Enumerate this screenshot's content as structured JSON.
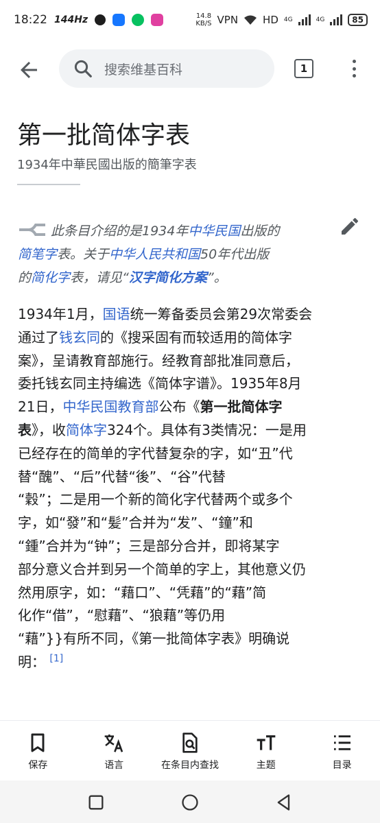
{
  "status_bar": {
    "time": "18:22",
    "refresh_rate": "144Hz",
    "net_speed_value": "14.8",
    "net_speed_unit": "KB/S",
    "vpn": "VPN",
    "hd": "HD",
    "network_1": "4G",
    "network_2": "4G",
    "battery": "85"
  },
  "top_bar": {
    "search_placeholder": "搜索维基百科",
    "tab_count": "1"
  },
  "article": {
    "title": "第一批简体字表",
    "description": "1934年中華民國出版的簡筆字表"
  },
  "hatnote": {
    "l1_a": "此条目介绍的是1934年",
    "l1_link": "中华民国",
    "l1_b": "出版的",
    "l2_link1": "简笔字",
    "l2_a": "表。关于",
    "l2_link2": "中华人民共和国",
    "l2_b": "50年代出版",
    "l3_a": "的",
    "l3_link1": "简化字",
    "l3_b": "表，请见“",
    "l3_link2": "汉字简化方案",
    "l3_c": "”。"
  },
  "body": {
    "l1_a": "1934年1月，",
    "l1_link": "国语",
    "l1_b": "统一筹备委员会第29次常委会",
    "l2_a": "通过了",
    "l2_link": "钱玄同",
    "l2_b": "的《搜采固有而较适用的简体字",
    "l3": "案》，呈请教育部施行。经教育部批准同意后，",
    "l4": "委托钱玄同主持编选《简体字谱》。1935年8月",
    "l5_a": "21日，",
    "l5_link": "中华民国教育部",
    "l5_b": "公布《",
    "l5_bold": "第一批简体字",
    "l6_bold": "表",
    "l6_a": "》，收",
    "l6_link": "简体字",
    "l6_b": "324个。具体有3类情况：一是用",
    "l7": "已经存在的简单的字代替复杂的字，如“丑”代",
    "l8": "替“醜”、“后”代替“後”、“谷”代替",
    "l9": "“穀”；二是用一个新的简化字代替两个或多个",
    "l10": "字，如“發”和“髪”合并为“发”、“鐘”和",
    "l11": "“鍾”合并为“钟”；三是部分合并，即将某字",
    "l12": "部分意义合并到另一个简单的字上，其他意义仍",
    "l13": "然用原字，如：“藉口”、“凭藉”的“藉”简",
    "l14": "化作“借”，“慰藉”、“狼藉”等仍用",
    "l15": "“藉”}}有所不同，《第一批简体字表》明确说",
    "l16": "明：",
    "ref": "[1]"
  },
  "bottom_nav": {
    "save": "保存",
    "language": "语言",
    "find": "在条目内查找",
    "theme": "主题",
    "contents": "目录"
  },
  "colors": {
    "link": "#3366cc",
    "text": "#202122",
    "muted": "#54595d",
    "search_bg": "#f1f3f5"
  }
}
